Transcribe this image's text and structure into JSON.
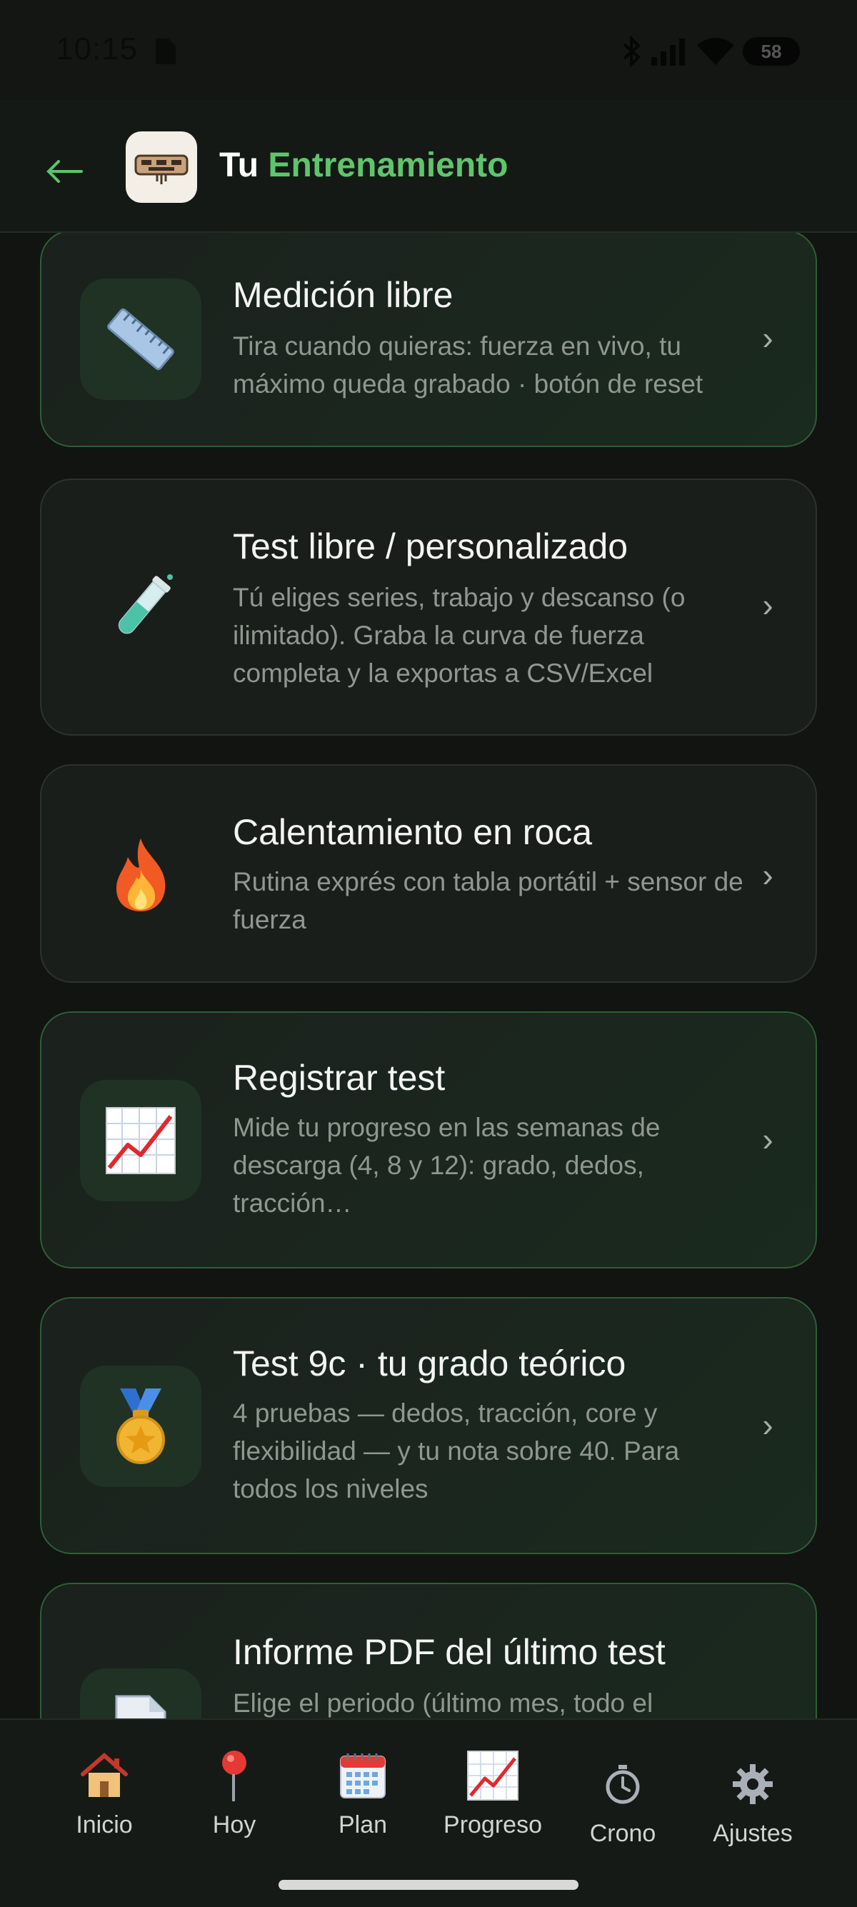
{
  "status": {
    "time": "10:15",
    "battery": "58"
  },
  "header": {
    "title_prefix": "Tu",
    "title_accent": "Entrenamiento",
    "accent_color": "#5fc56d"
  },
  "cards": [
    {
      "title": "Medición libre",
      "desc": "Tira cuando quieras: fuerza en vivo, tu máximo queda grabado · botón de reset",
      "icon": "ruler-icon"
    },
    {
      "title": "Test libre / personalizado",
      "desc": "Tú eliges series, trabajo y descanso (o ilimitado). Graba la curva de fuerza completa y la exportas a CSV/Excel",
      "icon": "test-tube-icon"
    },
    {
      "title": "Calentamiento en roca",
      "desc": "Rutina exprés con tabla portátil + sensor de fuerza",
      "icon": "fire-icon"
    },
    {
      "title": "Registrar test",
      "desc": "Mide tu progreso en las semanas de descarga (4, 8 y 12): grado, dedos, tracción…",
      "icon": "chart-up-icon"
    },
    {
      "title": "Test 9c · tu grado teórico",
      "desc": "4 pruebas — dedos, tracción, core y flexibilidad — y tu nota sobre 40. Para todos los niveles",
      "icon": "medal-icon"
    },
    {
      "title": "Informe PDF del último test",
      "desc": "Elige el periodo (último mes, todo el",
      "icon": "document-icon"
    }
  ],
  "chevron": "›",
  "nav": [
    {
      "label": "Inicio",
      "icon": "house-icon"
    },
    {
      "label": "Hoy",
      "icon": "pin-icon"
    },
    {
      "label": "Plan",
      "icon": "calendar-icon"
    },
    {
      "label": "Progreso",
      "icon": "chart-up-icon"
    },
    {
      "label": "Crono",
      "icon": "stopwatch-icon"
    },
    {
      "label": "Ajustes",
      "icon": "gear-icon"
    }
  ]
}
